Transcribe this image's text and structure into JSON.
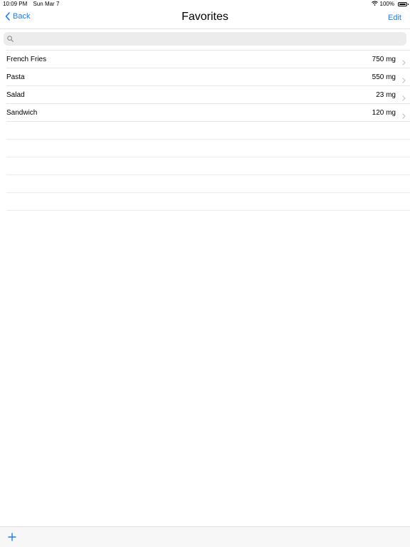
{
  "status_bar": {
    "time": "10:09 PM",
    "date": "Sun Mar 7",
    "battery": "100%"
  },
  "nav": {
    "back_label": "Back",
    "title": "Favorites",
    "edit_label": "Edit"
  },
  "search": {
    "placeholder": "",
    "value": ""
  },
  "items": [
    {
      "name": "French Fries",
      "value": "750 mg"
    },
    {
      "name": "Pasta",
      "value": "550 mg"
    },
    {
      "name": "Salad",
      "value": "23 mg"
    },
    {
      "name": "Sandwich",
      "value": "120 mg"
    }
  ],
  "colors": {
    "accent": "#1a7cf5",
    "separator": "#e6e6e6",
    "search_bg": "#ececec",
    "toolbar_bg": "#f7f7f7"
  },
  "icons": {
    "wifi": "wifi-icon",
    "battery": "battery-icon",
    "back": "chevron-left-icon",
    "search": "search-icon",
    "row": "chevron-right-icon",
    "add": "plus-icon"
  }
}
